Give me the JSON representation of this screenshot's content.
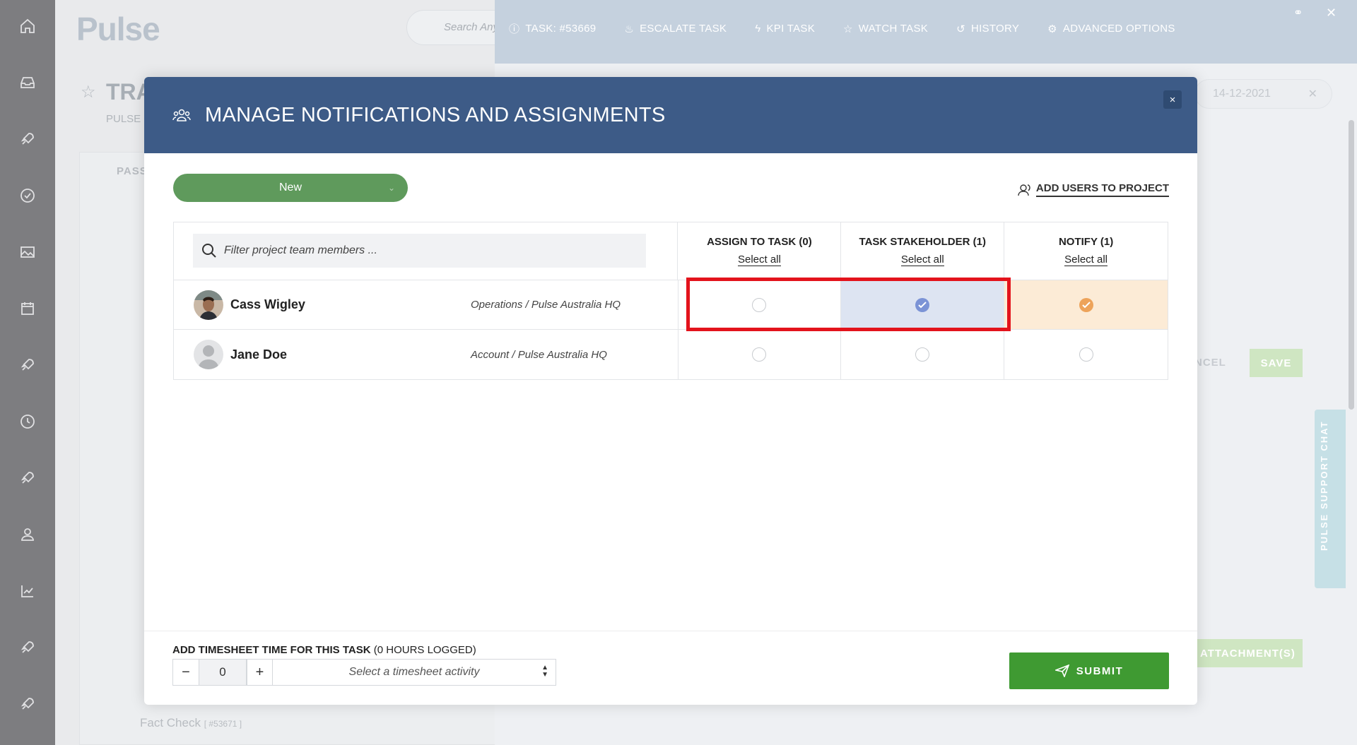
{
  "app": {
    "logo": "Pulse",
    "search_placeholder": "Search Any"
  },
  "background": {
    "page_title": "TRA",
    "page_sub": "PULSE",
    "card_tab": "PASS",
    "task_fact": "Fact Check",
    "task_fact_id": "[ #53671 ]",
    "date_value": "14-12-2021",
    "cancel_label": "NCEL",
    "save_label": "SAVE",
    "attach_label": "ATTACHMENT(S)",
    "support_chat": "PULSE SUPPORT CHAT"
  },
  "task_bar": {
    "task_id": "TASK: #53669",
    "escalate": "ESCALATE TASK",
    "kpi": "KPI TASK",
    "watch": "WATCH TASK",
    "history": "HISTORY",
    "advanced": "ADVANCED OPTIONS"
  },
  "modal": {
    "title": "MANAGE NOTIFICATIONS AND ASSIGNMENTS",
    "close": "×",
    "status_value": "New",
    "add_users": "ADD USERS TO PROJECT",
    "filter_placeholder": "Filter project team members ...",
    "columns": [
      {
        "title": "ASSIGN TO TASK (0)",
        "select_all": "Select all"
      },
      {
        "title": "TASK STAKEHOLDER (1)",
        "select_all": "Select all"
      },
      {
        "title": "NOTIFY (1)",
        "select_all": "Select all"
      }
    ],
    "members": [
      {
        "name": "Cass Wigley",
        "dept": "Operations / Pulse Australia HQ",
        "assign": false,
        "stakeholder": true,
        "notify": true
      },
      {
        "name": "Jane Doe",
        "dept": "Account / Pulse Australia HQ",
        "assign": false,
        "stakeholder": false,
        "notify": false
      }
    ],
    "timesheet": {
      "label_bold": "ADD TIMESHEET TIME FOR THIS TASK",
      "label_rest": " (0 HOURS LOGGED)",
      "minus": "−",
      "plus": "+",
      "value": "0",
      "activity_placeholder": "Select a timesheet activity"
    },
    "submit": "SUBMIT"
  },
  "colors": {
    "header": "#3d5b87",
    "status": "#5f9a5c",
    "submit": "#3f9a32",
    "stakeholder": "#7b93d6",
    "notify": "#eda35a",
    "highlight": "#e3131c"
  }
}
